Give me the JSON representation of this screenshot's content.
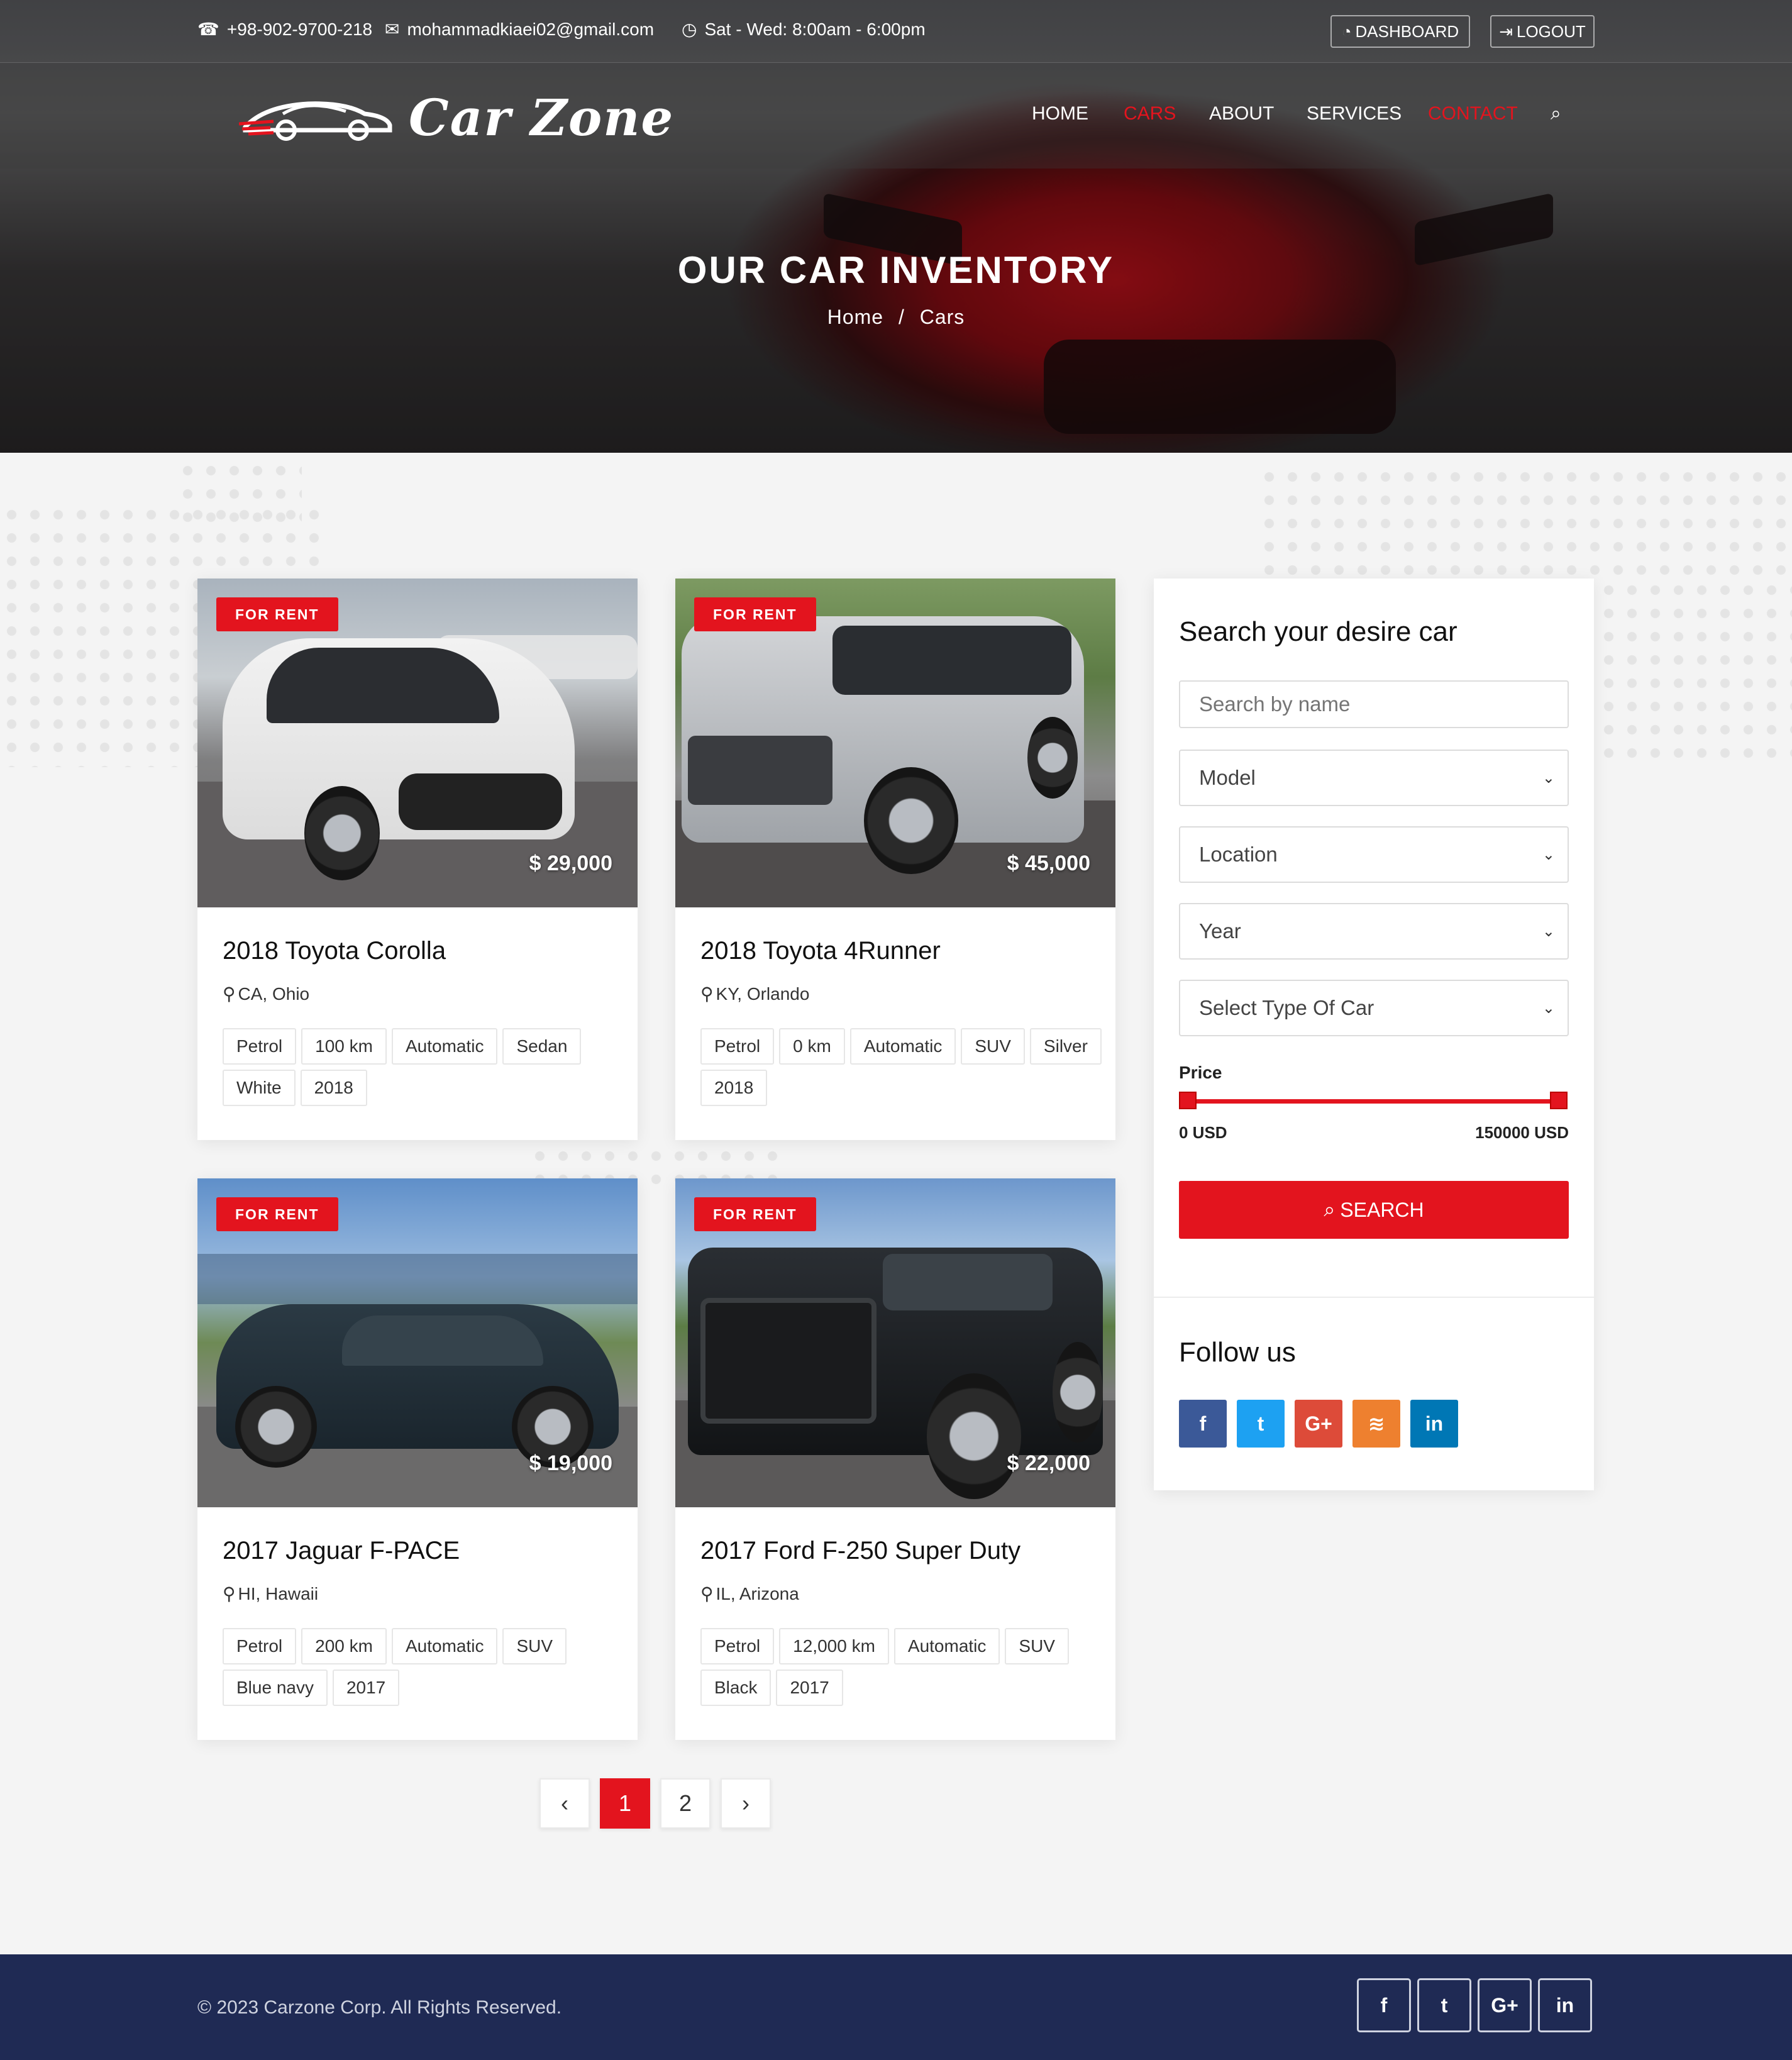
{
  "topbar": {
    "phone": "+98-902-9700-218",
    "email": "mohammadkiaei02@gmail.com",
    "hours": "Sat - Wed: 8:00am - 6:00pm",
    "dashboard": "DASHBOARD",
    "logout": "LOGOUT"
  },
  "brand": {
    "name": "Car Zone"
  },
  "nav": {
    "home": "HOME",
    "cars": "CARS",
    "about": "ABOUT",
    "services": "SERVICES",
    "contact": "CONTACT",
    "active": "CARS"
  },
  "hero": {
    "title": "OUR CAR INVENTORY",
    "crumb_home": "Home",
    "crumb_sep": "/",
    "crumb_current": "Cars"
  },
  "cars": [
    {
      "badge": "FOR RENT",
      "price": "$ 29,000",
      "title": "2018 Toyota Corolla",
      "location": "CA, Ohio",
      "tags": [
        "Petrol",
        "100 km",
        "Automatic",
        "Sedan",
        "White",
        "2018"
      ]
    },
    {
      "badge": "FOR RENT",
      "price": "$ 45,000",
      "title": "2018 Toyota 4Runner",
      "location": "KY, Orlando",
      "tags": [
        "Petrol",
        "0 km",
        "Automatic",
        "SUV",
        "Silver",
        "2018"
      ]
    },
    {
      "badge": "FOR RENT",
      "price": "$ 19,000",
      "title": "2017 Jaguar F-PACE",
      "location": "HI, Hawaii",
      "tags": [
        "Petrol",
        "200 km",
        "Automatic",
        "SUV",
        "Blue navy",
        "2017"
      ]
    },
    {
      "badge": "FOR RENT",
      "price": "$ 22,000",
      "title": "2017 Ford F-250 Super Duty",
      "location": "IL, Arizona",
      "tags": [
        "Petrol",
        "12,000 km",
        "Automatic",
        "SUV",
        "Black",
        "2017"
      ]
    }
  ],
  "search": {
    "heading": "Search your desire car",
    "name_placeholder": "Search by name",
    "model": "Model",
    "location": "Location",
    "year": "Year",
    "type": "Select Type Of Car",
    "price_label": "Price",
    "price_min": "0 USD",
    "price_max": "150000 USD",
    "price_range_fraction": [
      0,
      1
    ],
    "button": "SEARCH"
  },
  "follow": {
    "heading": "Follow us",
    "icons": [
      "facebook-icon",
      "twitter-icon",
      "google-plus-icon",
      "rss-icon",
      "linkedin-icon"
    ],
    "glyphs": {
      "facebook": "f",
      "twitter": "t",
      "google": "G+",
      "rss": "≋",
      "linkedin": "in"
    },
    "colors": {
      "facebook": "#3b5998",
      "twitter": "#1da1f2",
      "google": "#dd4b39",
      "rss": "#ee802f",
      "linkedin": "#0077b5"
    }
  },
  "pagination": {
    "prev": "‹",
    "pages": [
      "1",
      "2"
    ],
    "active": "1",
    "next": "›"
  },
  "footer": {
    "copyright": "© 2023 Carzone Corp. All Rights Reserved.",
    "glyphs": {
      "facebook": "f",
      "twitter": "t",
      "google": "G+",
      "linkedin": "in"
    }
  },
  "colors": {
    "accent": "#e3141e",
    "footer_bg": "#1f2a54"
  }
}
